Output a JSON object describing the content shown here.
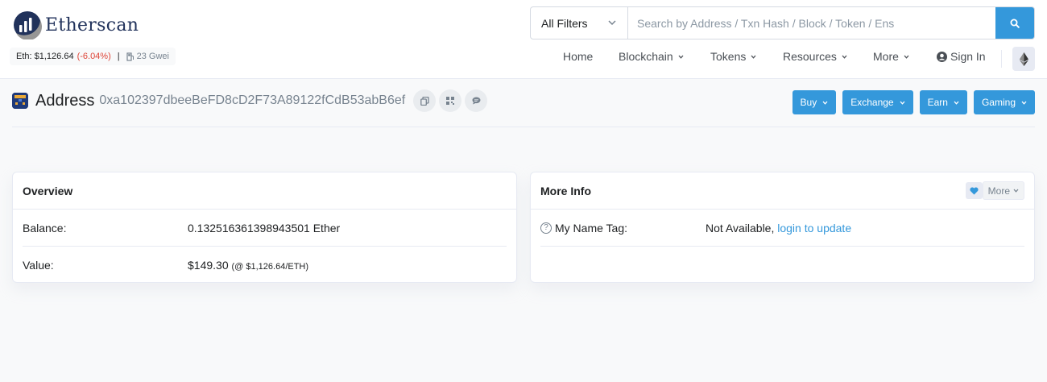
{
  "brand": {
    "name": "Etherscan"
  },
  "price": {
    "eth_label": "Eth: $1,126.64",
    "change": "(-6.04%)",
    "separator": "|",
    "gas": "23 Gwei"
  },
  "search": {
    "filter": "All Filters",
    "placeholder": "Search by Address / Txn Hash / Block / Token / Ens"
  },
  "nav": {
    "home": "Home",
    "blockchain": "Blockchain",
    "tokens": "Tokens",
    "resources": "Resources",
    "more": "More",
    "signin": "Sign In"
  },
  "address": {
    "title": "Address",
    "hash": "0xa102397dbeeBeFD8cD2F73A89122fCdB53abB6ef"
  },
  "actions": {
    "buy": "Buy",
    "exchange": "Exchange",
    "earn": "Earn",
    "gaming": "Gaming"
  },
  "overview": {
    "title": "Overview",
    "balance_label": "Balance:",
    "balance_value": "0.132516361398943501 Ether",
    "value_label": "Value:",
    "value_amount": "$149.30",
    "value_rate": "(@ $1,126.64/ETH)"
  },
  "more_info": {
    "title": "More Info",
    "more_label": "More",
    "name_tag_label": "My Name Tag:",
    "name_tag_value": "Not Available,",
    "name_tag_link": "login to update"
  },
  "colors": {
    "accent": "#3498db",
    "negative": "#de4437",
    "brand": "#21325b"
  }
}
